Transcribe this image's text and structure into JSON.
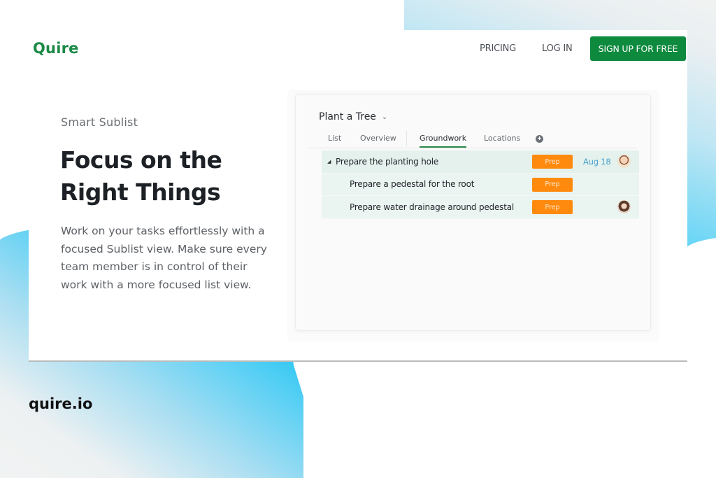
{
  "header": {
    "logo": "Quire",
    "nav": {
      "pricing": "PRICING",
      "login": "LOG IN",
      "signup": "SIGN UP FOR FREE"
    }
  },
  "hero": {
    "eyebrow": "Smart Sublist",
    "headline": "Focus on the Right Things",
    "description": "Work on your tasks effortlessly with a focused Sublist view. Make sure every team member is in control of their work with a more focused list view."
  },
  "app_preview": {
    "project_title": "Plant a Tree",
    "tabs": [
      {
        "label": "List",
        "active": false
      },
      {
        "label": "Overview",
        "active": false
      },
      {
        "label": "Groundwork",
        "active": true
      },
      {
        "label": "Locations",
        "active": false
      }
    ],
    "add_tab_icon": "plus-circle-icon",
    "tasks": [
      {
        "name": "Prepare the planting hole",
        "tag": "Prep",
        "due": "Aug 18",
        "assignee": "male-avatar",
        "level": 0,
        "expanded": true
      },
      {
        "name": "Prepare a pedestal for the root",
        "tag": "Prep",
        "due": "",
        "assignee": "",
        "level": 1
      },
      {
        "name": "Prepare water drainage around pedestal",
        "tag": "Prep",
        "due": "",
        "assignee": "female-avatar",
        "level": 1
      }
    ]
  },
  "footer": {
    "domain": "quire.io"
  },
  "colors": {
    "brand_green": "#0d8a3e",
    "tag_orange": "#ff8a0d",
    "date_blue": "#4aa3cf",
    "accent_cyan": "#00bbf0"
  }
}
